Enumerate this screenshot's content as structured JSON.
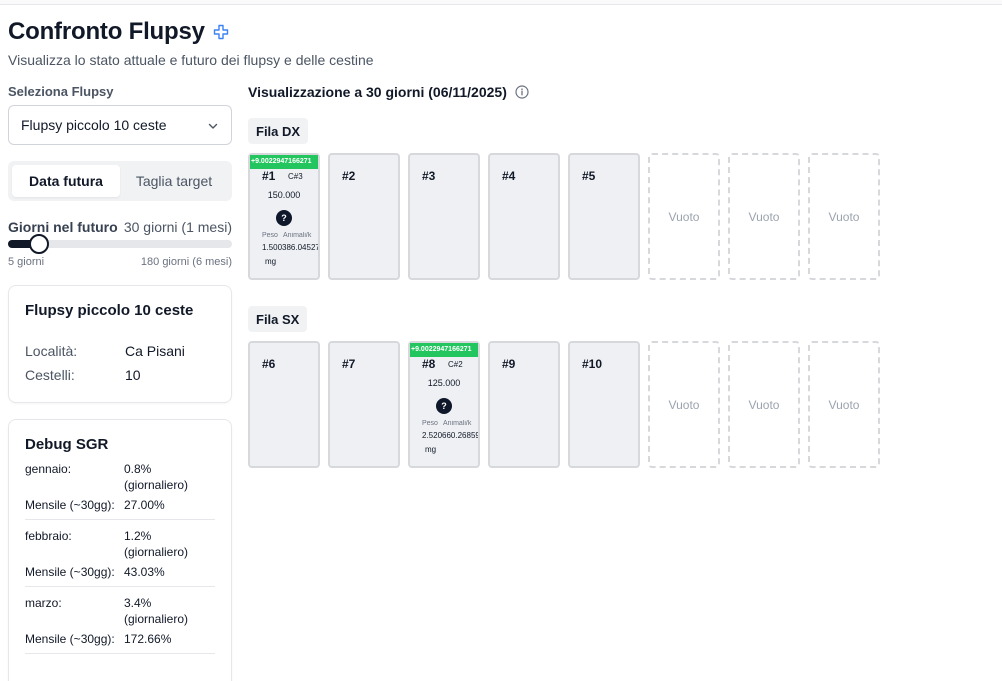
{
  "header": {
    "title": "Confronto Flupsy",
    "subtitle": "Visualizza lo stato attuale e futuro dei flupsy e delle cestine",
    "title_icon": "plus-circle-icon"
  },
  "controls": {
    "select_label": "Seleziona Flupsy",
    "select_value": "Flupsy piccolo 10 ceste",
    "tabs": [
      "Data futura",
      "Taglia target"
    ],
    "active_tab": "Data futura",
    "days_label": "Giorni nel futuro",
    "days_value": "30 giorni (1 mesi)",
    "days_fraction": 0.14,
    "range_min": "5 giorni",
    "range_max": "180 giorni (6 mesi)"
  },
  "info": {
    "title": "Flupsy piccolo 10 ceste",
    "location_label": "Località:",
    "location_value": "Ca Pisani",
    "baskets_label": "Cestelli:",
    "baskets_value": "10"
  },
  "debug": {
    "title": "Debug SGR",
    "monthly_label": "Mensile (~30gg):",
    "months": [
      {
        "name": "gennaio:",
        "daily": "0.8%",
        "daily_note": "(giornaliero)",
        "monthly": "27.00%"
      },
      {
        "name": "febbraio:",
        "daily": "1.2%",
        "daily_note": "(giornaliero)",
        "monthly": "43.03%"
      },
      {
        "name": "marzo:",
        "daily": "3.4%",
        "daily_note": "(giornaliero)",
        "monthly": "172.66%"
      }
    ]
  },
  "visualization": {
    "title": "Visualizzazione a 30 giorni (06/11/2025)",
    "rows": [
      {
        "label": "Fila DX",
        "baskets": [
          {
            "number": "#1",
            "filled": true,
            "growth": "+9.0022947166271",
            "cycle": "C#3",
            "count": "150.000",
            "weight_label": "Peso",
            "animals_label": "Animali/k",
            "weight": "1.50038",
            "animals": "6.04527",
            "unit": "mg"
          },
          {
            "number": "#2",
            "filled": false
          },
          {
            "number": "#3",
            "filled": false
          },
          {
            "number": "#4",
            "filled": false
          },
          {
            "number": "#5",
            "filled": false
          }
        ],
        "empty_slots": [
          "Vuoto",
          "Vuoto",
          "Vuoto"
        ]
      },
      {
        "label": "Fila SX",
        "baskets": [
          {
            "number": "#6",
            "filled": false
          },
          {
            "number": "#7",
            "filled": false
          },
          {
            "number": "#8",
            "filled": true,
            "growth": "+9.0022947166271",
            "cycle": "C#2",
            "count": "125.000",
            "weight_label": "Peso",
            "animals_label": "Animali/k",
            "weight": "2.52066",
            "animals": "0.26859",
            "unit": "mg"
          },
          {
            "number": "#9",
            "filled": false
          },
          {
            "number": "#10",
            "filled": false
          }
        ],
        "empty_slots": [
          "Vuoto",
          "Vuoto",
          "Vuoto"
        ]
      }
    ]
  }
}
